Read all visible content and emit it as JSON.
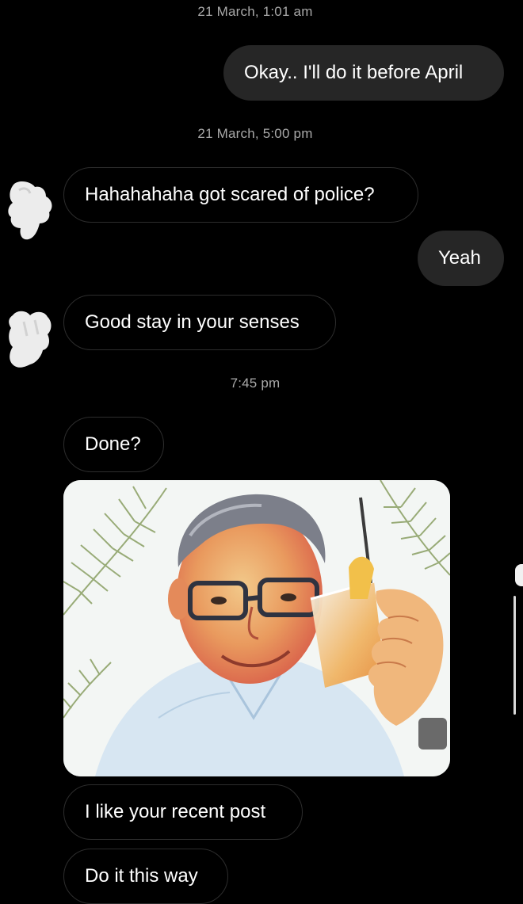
{
  "thread": {
    "timestamps": {
      "t1": "21 March, 1:01 am",
      "t2": "21 March, 5:00 pm",
      "t3": "7:45 pm"
    },
    "messages": {
      "m1": "Okay.. I'll do it before April",
      "m2": "Hahahahaha got scared of police?",
      "m3": "Yeah",
      "m4": "Good stay in your senses",
      "m5": "Done?",
      "m7": "I like your recent post",
      "m8": "Do it this way"
    }
  },
  "colors": {
    "background": "#000000",
    "outgoing_bubble": "#262626",
    "incoming_border": "#2d2d2d",
    "timestamp_text": "#a9a9a9"
  },
  "icons": {
    "avatar_redacted_1": "redacted-avatar-icon",
    "avatar_redacted_2": "redacted-avatar-icon"
  }
}
